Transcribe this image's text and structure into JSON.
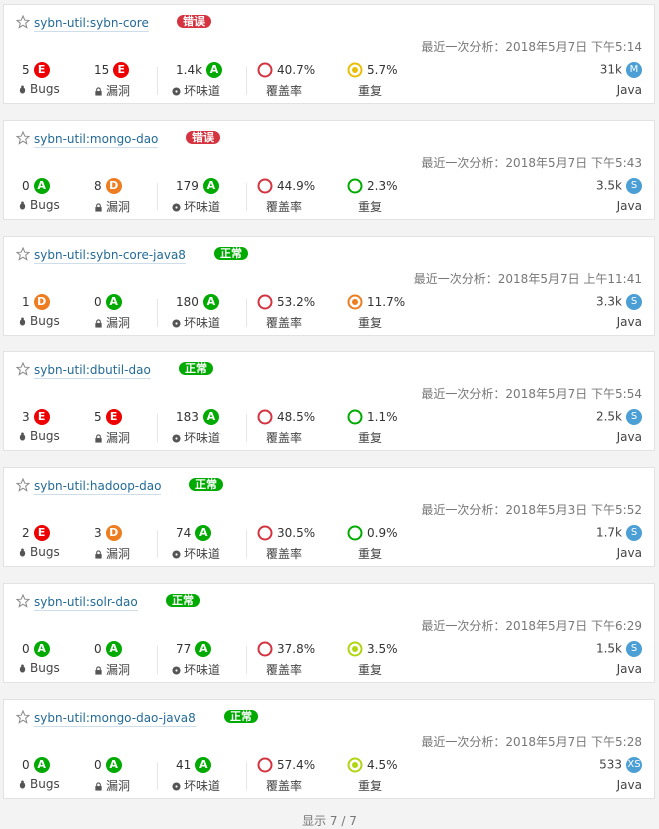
{
  "colors": {
    "A": "#00aa00",
    "B": "#b0d513",
    "C": "#eabe06",
    "D": "#ed7d20",
    "E": "#e00",
    "gate_error": "#d4333f",
    "gate_ok": "#00aa00",
    "link": "#236a97"
  },
  "labels": {
    "bugs": "Bugs",
    "vulns": "漏洞",
    "smells": "坏味道",
    "coverage": "覆盖率",
    "dup": "重复",
    "analysis_prefix": "最近一次分析："
  },
  "projects": [
    {
      "name": "sybn-util:sybn-core",
      "gate": "错误",
      "gate_type": "error",
      "analysis": "2018年5月7日 下午5:14",
      "bugs": "5",
      "bugs_r": "E",
      "vulns": "15",
      "vulns_r": "E",
      "smells": "1.4k",
      "smells_r": "A",
      "coverage": "40.7%",
      "cov_frac": 0.407,
      "dup": "5.7%",
      "dup_level": "C",
      "size": "31k",
      "size_r": "M",
      "lang": "Java"
    },
    {
      "name": "sybn-util:mongo-dao",
      "gate": "错误",
      "gate_type": "error",
      "analysis": "2018年5月7日 下午5:43",
      "bugs": "0",
      "bugs_r": "A",
      "vulns": "8",
      "vulns_r": "D",
      "smells": "179",
      "smells_r": "A",
      "coverage": "44.9%",
      "cov_frac": 0.449,
      "dup": "2.3%",
      "dup_level": "A",
      "size": "3.5k",
      "size_r": "S",
      "lang": "Java"
    },
    {
      "name": "sybn-util:sybn-core-java8",
      "gate": "正常",
      "gate_type": "ok",
      "analysis": "2018年5月7日 上午11:41",
      "bugs": "1",
      "bugs_r": "D",
      "vulns": "0",
      "vulns_r": "A",
      "smells": "180",
      "smells_r": "A",
      "coverage": "53.2%",
      "cov_frac": 0.532,
      "dup": "11.7%",
      "dup_level": "D",
      "size": "3.3k",
      "size_r": "S",
      "lang": "Java"
    },
    {
      "name": "sybn-util:dbutil-dao",
      "gate": "正常",
      "gate_type": "ok",
      "analysis": "2018年5月7日 下午5:54",
      "bugs": "3",
      "bugs_r": "E",
      "vulns": "5",
      "vulns_r": "E",
      "smells": "183",
      "smells_r": "A",
      "coverage": "48.5%",
      "cov_frac": 0.485,
      "dup": "1.1%",
      "dup_level": "A",
      "size": "2.5k",
      "size_r": "S",
      "lang": "Java"
    },
    {
      "name": "sybn-util:hadoop-dao",
      "gate": "正常",
      "gate_type": "ok",
      "analysis": "2018年5月3日 下午5:52",
      "bugs": "2",
      "bugs_r": "E",
      "vulns": "3",
      "vulns_r": "D",
      "smells": "74",
      "smells_r": "A",
      "coverage": "30.5%",
      "cov_frac": 0.305,
      "dup": "0.9%",
      "dup_level": "A",
      "size": "1.7k",
      "size_r": "S",
      "lang": "Java"
    },
    {
      "name": "sybn-util:solr-dao",
      "gate": "正常",
      "gate_type": "ok",
      "analysis": "2018年5月7日 下午6:29",
      "bugs": "0",
      "bugs_r": "A",
      "vulns": "0",
      "vulns_r": "A",
      "smells": "77",
      "smells_r": "A",
      "coverage": "37.8%",
      "cov_frac": 0.378,
      "dup": "3.5%",
      "dup_level": "B",
      "size": "1.5k",
      "size_r": "S",
      "lang": "Java"
    },
    {
      "name": "sybn-util:mongo-dao-java8",
      "gate": "正常",
      "gate_type": "ok",
      "analysis": "2018年5月7日 下午5:28",
      "bugs": "0",
      "bugs_r": "A",
      "vulns": "0",
      "vulns_r": "A",
      "smells": "41",
      "smells_r": "A",
      "coverage": "57.4%",
      "cov_frac": 0.574,
      "dup": "4.5%",
      "dup_level": "B",
      "size": "533",
      "size_r": "XS",
      "lang": "Java"
    }
  ],
  "footer": "显示 7 / 7"
}
